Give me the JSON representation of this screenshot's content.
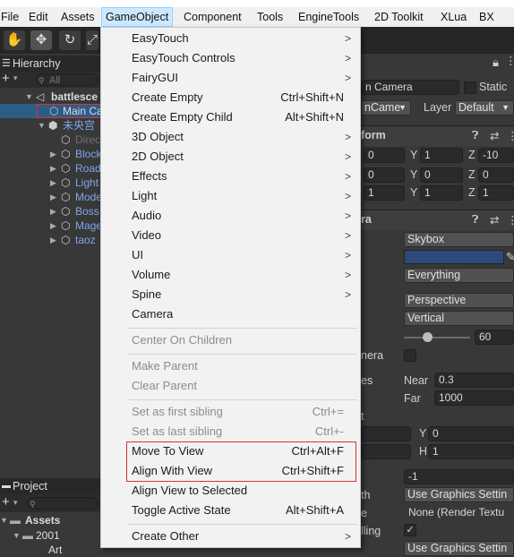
{
  "menubar": {
    "items": [
      "File",
      "Edit",
      "Assets",
      "GameObject",
      "Component",
      "Tools",
      "EngineTools",
      "2D Toolkit",
      "XLua",
      "BX PAC"
    ]
  },
  "hierarchy": {
    "tab_label": "Hierarchy",
    "search_placeholder": "All",
    "rows": [
      "battlesce",
      "Main Ca",
      "未央宫",
      "Direc",
      "Block",
      "Road",
      "Light",
      "Mode",
      "Boss",
      "Mage",
      "taoz"
    ]
  },
  "project": {
    "tab_label": "Project",
    "assets_label": "Assets",
    "folder_label": "2001",
    "folder_child": "Art"
  },
  "inspector": {
    "name_value": "n Camera",
    "static_label": "Static",
    "tag_value": "nCame",
    "layer_label": "Layer",
    "layer_value": "Default",
    "transform_label": "form",
    "camera_label": "ra",
    "pos": {
      "x": "0",
      "y": "1",
      "z": "-10"
    },
    "rot": {
      "x": "0",
      "y": "0",
      "z": "0"
    },
    "scale": {
      "x": "1",
      "y": "1",
      "z": "1"
    },
    "axis_x": "X",
    "axis_y": "Y",
    "axis_z": "Z",
    "clear_flags": "Skybox",
    "culling_mask": "Everything",
    "projection": "Perspective",
    "fov_axis": "Vertical",
    "fov_value": "60",
    "physical_camera_label": "nera",
    "clipping_label": "es",
    "near_label": "Near",
    "near_value": "0.3",
    "far_label": "Far",
    "far_value": "1000",
    "rect_label": "t",
    "rect_y_label": "Y",
    "rect_y": "0",
    "rect_h_label": "H",
    "rect_h": "1",
    "depth_value": "-1",
    "render_path_label": "th",
    "render_path": "Use Graphics Settin",
    "target_texture_label": "e",
    "target_texture": "None (Render Textu",
    "occlusion_label": "lling",
    "hdr_value": "Use Graphics Settin",
    "sky_color": "#2d4a7a"
  },
  "menu": {
    "items": [
      {
        "label": "EasyTouch",
        "shortcut": "",
        "submenu": true,
        "disabled": false
      },
      {
        "label": "EasyTouch Controls",
        "shortcut": "",
        "submenu": true,
        "disabled": false
      },
      {
        "label": "FairyGUI",
        "shortcut": "",
        "submenu": true,
        "disabled": false
      },
      {
        "label": "Create Empty",
        "shortcut": "Ctrl+Shift+N",
        "submenu": false,
        "disabled": false
      },
      {
        "label": "Create Empty Child",
        "shortcut": "Alt+Shift+N",
        "submenu": false,
        "disabled": false
      },
      {
        "label": "3D Object",
        "shortcut": "",
        "submenu": true,
        "disabled": false
      },
      {
        "label": "2D Object",
        "shortcut": "",
        "submenu": true,
        "disabled": false
      },
      {
        "label": "Effects",
        "shortcut": "",
        "submenu": true,
        "disabled": false
      },
      {
        "label": "Light",
        "shortcut": "",
        "submenu": true,
        "disabled": false
      },
      {
        "label": "Audio",
        "shortcut": "",
        "submenu": true,
        "disabled": false
      },
      {
        "label": "Video",
        "shortcut": "",
        "submenu": true,
        "disabled": false
      },
      {
        "label": "UI",
        "shortcut": "",
        "submenu": true,
        "disabled": false
      },
      {
        "label": "Volume",
        "shortcut": "",
        "submenu": true,
        "disabled": false
      },
      {
        "label": "Spine",
        "shortcut": "",
        "submenu": true,
        "disabled": false
      },
      {
        "label": "Camera",
        "shortcut": "",
        "submenu": false,
        "disabled": false
      },
      {
        "label": "Center On Children",
        "shortcut": "",
        "submenu": false,
        "disabled": true
      },
      {
        "label": "Make Parent",
        "shortcut": "",
        "submenu": false,
        "disabled": true
      },
      {
        "label": "Clear Parent",
        "shortcut": "",
        "submenu": false,
        "disabled": true
      },
      {
        "label": "Set as first sibling",
        "shortcut": "Ctrl+=",
        "submenu": false,
        "disabled": true
      },
      {
        "label": "Set as last sibling",
        "shortcut": "Ctrl+-",
        "submenu": false,
        "disabled": true
      },
      {
        "label": "Move To View",
        "shortcut": "Ctrl+Alt+F",
        "submenu": false,
        "disabled": false
      },
      {
        "label": "Align With View",
        "shortcut": "Ctrl+Shift+F",
        "submenu": false,
        "disabled": false
      },
      {
        "label": "Align View to Selected",
        "shortcut": "",
        "submenu": false,
        "disabled": false
      },
      {
        "label": "Toggle Active State",
        "shortcut": "Alt+Shift+A",
        "submenu": false,
        "disabled": false
      },
      {
        "label": "Create Other",
        "shortcut": "",
        "submenu": true,
        "disabled": false
      }
    ]
  }
}
